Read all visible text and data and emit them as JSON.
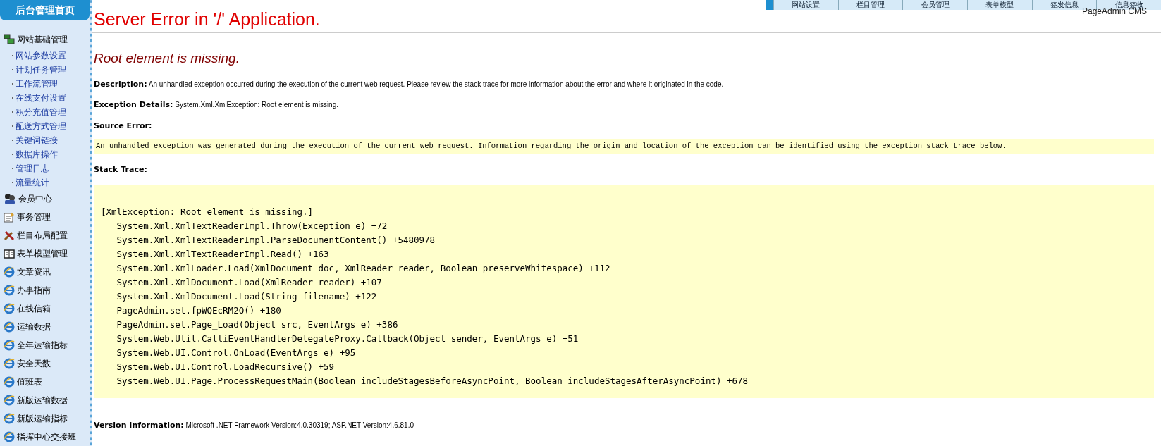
{
  "sidebar": {
    "header": "后台管理首页",
    "items": [
      {
        "label": "网站基础管理",
        "kind": "network",
        "children": [
          {
            "label": "网站参数设置"
          },
          {
            "label": "计划任务管理"
          },
          {
            "label": "工作流管理"
          },
          {
            "label": "在线支付设置"
          },
          {
            "label": "积分充值管理"
          },
          {
            "label": "配送方式管理"
          },
          {
            "label": "关键词链接"
          },
          {
            "label": "数据库操作"
          },
          {
            "label": "管理日志"
          },
          {
            "label": "流量统计"
          }
        ]
      },
      {
        "label": "会员中心",
        "kind": "members"
      },
      {
        "label": "事务管理",
        "kind": "tasks"
      },
      {
        "label": "栏目布局配置",
        "kind": "tools"
      },
      {
        "label": "表单模型管理",
        "kind": "forms"
      },
      {
        "label": "文章资讯",
        "kind": "page"
      },
      {
        "label": "办事指南",
        "kind": "page"
      },
      {
        "label": "在线信箱",
        "kind": "page"
      },
      {
        "label": "运输数据",
        "kind": "page"
      },
      {
        "label": "全年运输指标",
        "kind": "page"
      },
      {
        "label": "安全天数",
        "kind": "page"
      },
      {
        "label": "值班表",
        "kind": "page"
      },
      {
        "label": "新版运输数据",
        "kind": "page"
      },
      {
        "label": "新版运输指标",
        "kind": "page"
      },
      {
        "label": "指挥中心交接班",
        "kind": "page"
      }
    ]
  },
  "top_tabs": [
    "网站设置",
    "栏目管理",
    "会员管理",
    "表单模型",
    "签发信息",
    "信息签收"
  ],
  "brand": "PageAdmin CMS",
  "error": {
    "title": "Server Error in '/' Application.",
    "heading": "Root element is missing.",
    "description_label": "Description:",
    "description": "An unhandled exception occurred during the execution of the current web request. Please review the stack trace for more information about the error and where it originated in the code.",
    "details_label": "Exception Details:",
    "details": "System.Xml.XmlException: Root element is missing.",
    "source_label": "Source Error:",
    "source": "An unhandled exception was generated during the execution of the current web request. Information regarding the origin and location of the exception can be identified using the exception stack trace below.",
    "stack_label": "Stack Trace:",
    "stack": [
      "[XmlException: Root element is missing.]",
      "   System.Xml.XmlTextReaderImpl.Throw(Exception e) +72",
      "   System.Xml.XmlTextReaderImpl.ParseDocumentContent() +5480978",
      "   System.Xml.XmlTextReaderImpl.Read() +163",
      "   System.Xml.XmlLoader.Load(XmlDocument doc, XmlReader reader, Boolean preserveWhitespace) +112",
      "   System.Xml.XmlDocument.Load(XmlReader reader) +107",
      "   System.Xml.XmlDocument.Load(String filename) +122",
      "   PageAdmin.set.fpWQEcRM2O() +180",
      "   PageAdmin.set.Page_Load(Object src, EventArgs e) +386",
      "   System.Web.Util.CalliEventHandlerDelegateProxy.Callback(Object sender, EventArgs e) +51",
      "   System.Web.UI.Control.OnLoad(EventArgs e) +95",
      "   System.Web.UI.Control.LoadRecursive() +59",
      "   System.Web.UI.Page.ProcessRequestMain(Boolean includeStagesBeforeAsyncPoint, Boolean includeStagesAfterAsyncPoint) +678"
    ],
    "version_label": "Version Information:",
    "version": "Microsoft .NET Framework Version:4.0.30319; ASP.NET Version:4.6.81.0"
  }
}
